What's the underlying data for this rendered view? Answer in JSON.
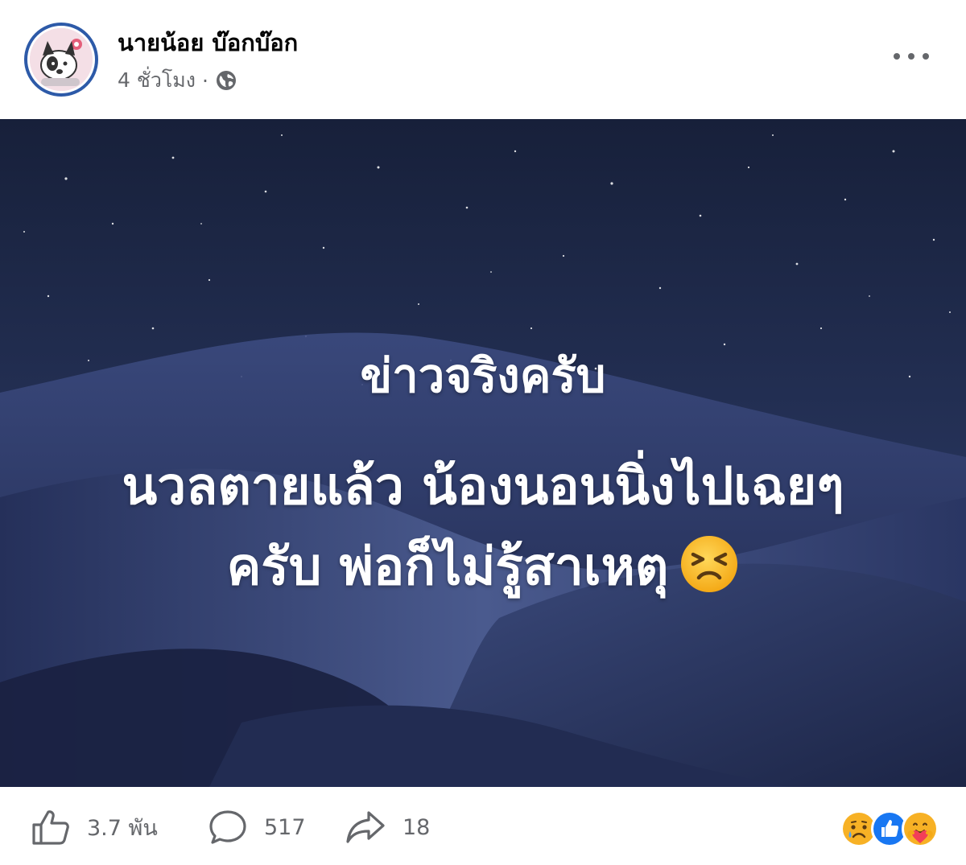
{
  "post": {
    "author": "นายน้อย บ๊อกบ๊อก",
    "time": "4 ชั่วโมง",
    "separator": "·",
    "privacy_icon": "globe-icon",
    "more_icon": "more-options-icon"
  },
  "image": {
    "line1": "ข่าวจริงครับ",
    "line2": "นวลตายแล้ว น้องนอนนิ่งไปเฉยๆ",
    "line3": "ครับ พ่อก็ไม่รู้สาเหตุ",
    "emoji": "tired-face-emoji"
  },
  "footer": {
    "likes": "3.7 พัน",
    "comments": "517",
    "shares": "18",
    "reactions": [
      "sad-reaction",
      "like-reaction",
      "care-reaction"
    ]
  },
  "colors": {
    "secondary_text": "#65676b",
    "primary_text": "#050505",
    "like_blue": "#1877f2",
    "reaction_yellow": "#f7b125",
    "sky_dark": "#1b2545"
  }
}
